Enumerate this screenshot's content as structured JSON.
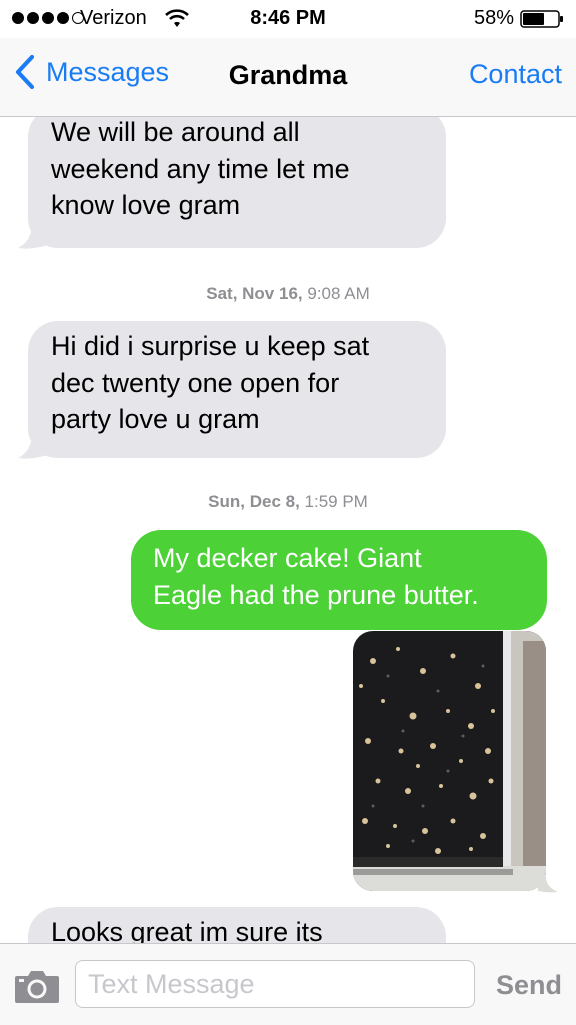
{
  "status_bar": {
    "carrier": "Verizon",
    "time": "8:46 PM",
    "battery": "58%",
    "signal_bars_filled": 4,
    "signal_bars_total": 5
  },
  "nav": {
    "back_label": "Messages",
    "title": "Grandma",
    "contact_label": "Contact"
  },
  "messages": [
    {
      "direction": "incoming",
      "lines": [
        "We will be around all",
        "weekend  any  time  let me",
        "know  love gram"
      ]
    },
    {
      "type": "timestamp",
      "day": "Sat, Nov 16,",
      "time": "9:08 AM"
    },
    {
      "direction": "incoming",
      "lines": [
        "Hi did i surprise u keep sat",
        "dec twenty one open for",
        "party love u gram"
      ]
    },
    {
      "type": "timestamp",
      "day": "Sun, Dec 8,",
      "time": "1:59 PM"
    },
    {
      "direction": "outgoing",
      "lines": [
        "My decker cake! Giant",
        "Eagle had the prune butter."
      ]
    },
    {
      "direction": "outgoing",
      "type": "photo"
    },
    {
      "direction": "incoming",
      "lines": [
        "Looks great  im sure  its"
      ]
    }
  ],
  "input": {
    "placeholder": "Text Message",
    "send_label": "Send"
  },
  "colors": {
    "accent": "#1a7cf5",
    "incoming_bubble": "#e5e5ea",
    "outgoing_bubble": "#4cd137",
    "timestamp": "#8e8e93"
  }
}
